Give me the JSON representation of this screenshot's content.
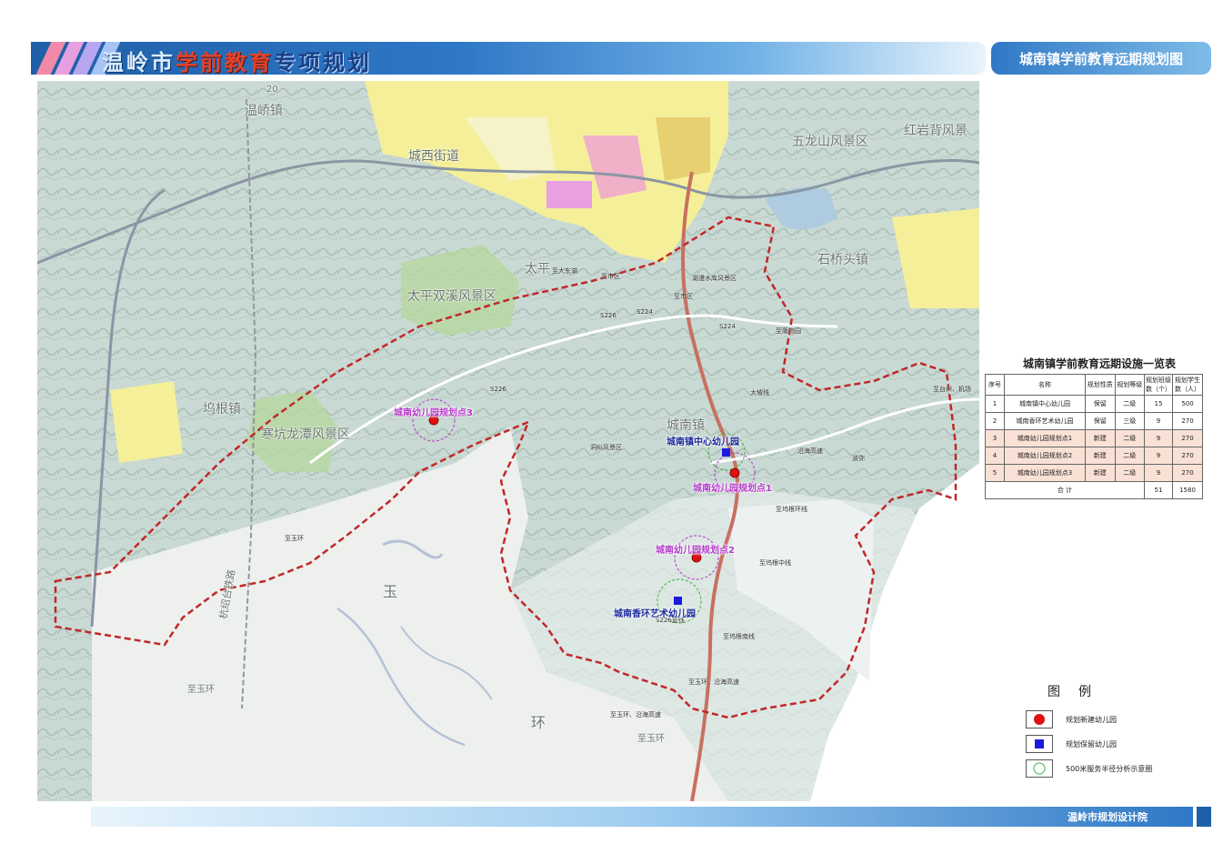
{
  "header": {
    "title_part1": "温岭市",
    "title_part2": "学前教育",
    "title_part3": "专项规划",
    "map_title": "城南镇学前教育远期规划图",
    "stripe_colors": [
      "#f08aa8",
      "#e6a0e0",
      "#b9a6f0",
      "#a7c4f5"
    ]
  },
  "map": {
    "place_names": [
      {
        "id": "wenqiao",
        "text": "温峤镇"
      },
      {
        "id": "chengxi",
        "text": "城西街道"
      },
      {
        "id": "wulongshan",
        "text": "五龙山风景区"
      },
      {
        "id": "hongyanbei",
        "text": "红岩背风景"
      },
      {
        "id": "taiping",
        "text": "太平"
      },
      {
        "id": "taiping_shuangxi",
        "text": "太平双溪风景区"
      },
      {
        "id": "shiqiaotou",
        "text": "石桥头镇"
      },
      {
        "id": "pogen",
        "text": "坞根镇"
      },
      {
        "id": "hankeng",
        "text": "寒坑龙潭风景区"
      },
      {
        "id": "chengnan",
        "text": "城南镇"
      },
      {
        "id": "yu",
        "text": "玉"
      },
      {
        "id": "huan",
        "text": "环"
      },
      {
        "id": "zhiyuhuan1",
        "text": "至玉环"
      },
      {
        "id": "zhiyuhuan2",
        "text": "至玉环"
      },
      {
        "id": "hangshao",
        "text": "杭绍台铁路"
      },
      {
        "id": "road_20",
        "text": "20"
      }
    ],
    "small_labels": [
      {
        "id": "s1",
        "text": "至大东湖"
      },
      {
        "id": "s2",
        "text": "至市区"
      },
      {
        "id": "s3",
        "text": "至市区"
      },
      {
        "id": "s4",
        "text": "湖漫水库风景区"
      },
      {
        "id": "s5",
        "text": "S226"
      },
      {
        "id": "s6",
        "text": "S224"
      },
      {
        "id": "s7",
        "text": "S224"
      },
      {
        "id": "s8",
        "text": "S226"
      },
      {
        "id": "s9",
        "text": "至藤物园"
      },
      {
        "id": "s10",
        "text": "至玉环"
      },
      {
        "id": "s11",
        "text": "大坡线"
      },
      {
        "id": "s12",
        "text": "至台州、机场"
      },
      {
        "id": "s13",
        "text": "沿海高速"
      },
      {
        "id": "s14",
        "text": "波弥"
      },
      {
        "id": "s15",
        "text": "至坞根环线"
      },
      {
        "id": "s16",
        "text": "至坞根中线"
      },
      {
        "id": "s17",
        "text": "至坞根南线"
      },
      {
        "id": "s18",
        "text": "S226复线"
      },
      {
        "id": "s19",
        "text": "至玉环、沿海高速"
      },
      {
        "id": "s20",
        "text": "至玉环、沿海高速"
      },
      {
        "id": "s21",
        "text": "洞纠风景区"
      }
    ],
    "kindergartens": [
      {
        "id": "k1",
        "label": "城南幼儿园规划点3",
        "type": "new"
      },
      {
        "id": "k2",
        "label": "城南镇中心幼儿园",
        "type": "keep"
      },
      {
        "id": "k3",
        "label": "城南幼儿园规划点1",
        "type": "new"
      },
      {
        "id": "k4",
        "label": "城南幼儿园规划点2",
        "type": "new"
      },
      {
        "id": "k5",
        "label": "城南香环艺术幼儿园",
        "type": "keep"
      }
    ],
    "colors": {
      "boundary": "#c0282a",
      "new_marker": "#e01010",
      "keep_marker": "#1a1ae0",
      "radius_new": "#b43cc8",
      "radius_keep": "#3cb43c"
    }
  },
  "table": {
    "title": "城南镇学前教育远期设施一览表",
    "headers": [
      "序号",
      "名称",
      "规划性质",
      "规划等级",
      "规划班级数（个）",
      "规划学生数（人）"
    ],
    "rows": [
      {
        "no": "1",
        "name": "城南镇中心幼儿园",
        "nature": "保留",
        "grade": "二级",
        "classes": "15",
        "students": "500",
        "highlight": false
      },
      {
        "no": "2",
        "name": "城南香环艺术幼儿园",
        "nature": "保留",
        "grade": "三级",
        "classes": "9",
        "students": "270",
        "highlight": false
      },
      {
        "no": "3",
        "name": "城南幼儿园规划点1",
        "nature": "新建",
        "grade": "二级",
        "classes": "9",
        "students": "270",
        "highlight": true
      },
      {
        "no": "4",
        "name": "城南幼儿园规划点2",
        "nature": "新建",
        "grade": "二级",
        "classes": "9",
        "students": "270",
        "highlight": true
      },
      {
        "no": "5",
        "name": "城南幼儿园规划点3",
        "nature": "新建",
        "grade": "二级",
        "classes": "9",
        "students": "270",
        "highlight": true
      }
    ],
    "total": {
      "label": "合    计",
      "classes": "51",
      "students": "1580"
    }
  },
  "legend": {
    "title": "图例",
    "items": [
      {
        "id": "new",
        "icon": "red-circle-icon",
        "text": "规划新建幼儿园"
      },
      {
        "id": "keep",
        "icon": "blue-square-icon",
        "text": "规划保留幼儿园"
      },
      {
        "id": "radius",
        "icon": "green-ring-icon",
        "text": "500米服务半径分析示意圈"
      }
    ]
  },
  "footer": {
    "org": "温岭市规划设计院"
  }
}
